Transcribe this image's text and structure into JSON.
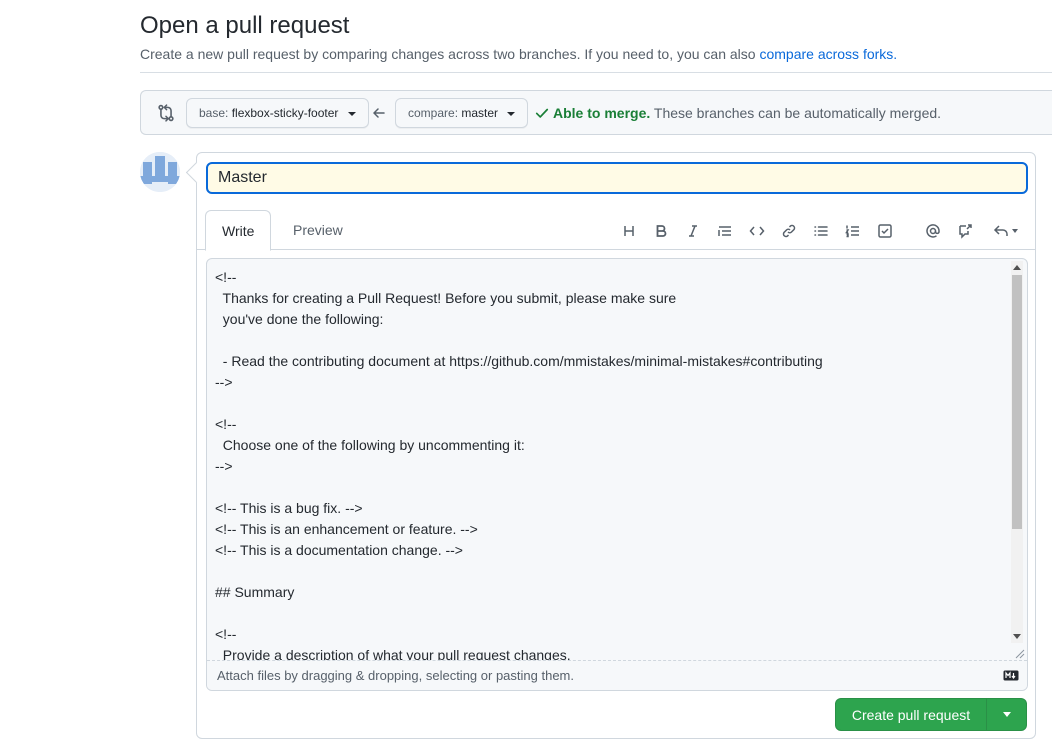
{
  "header": {
    "title": "Open a pull request",
    "subtitle": "Create a new pull request by comparing changes across two branches. If you need to, you can also ",
    "subtitle_link": "compare across forks."
  },
  "compare": {
    "base_label": "base:",
    "base_branch": "flexbox-sticky-footer",
    "compare_label": "compare:",
    "compare_branch": "master",
    "merge_ok": "Able to merge.",
    "merge_note": " These branches can be automatically merged."
  },
  "form": {
    "title_value": "Master",
    "tabs": [
      {
        "label": "Write"
      },
      {
        "label": "Preview"
      }
    ],
    "toolbar": [
      "heading-icon",
      "bold-icon",
      "italic-icon",
      "quote-icon",
      "code-icon",
      "link-icon",
      "bulleted-list-icon",
      "numbered-list-icon",
      "task-list-icon",
      "mention-icon",
      "reference-icon",
      "reply-icon"
    ],
    "body": "<!--\n  Thanks for creating a Pull Request! Before you submit, please make sure\n  you've done the following:\n\n  - Read the contributing document at https://github.com/mmistakes/minimal-mistakes#contributing\n-->\n\n<!--\n  Choose one of the following by uncommenting it:\n-->\n\n<!-- This is a bug fix. -->\n<!-- This is an enhancement or feature. -->\n<!-- This is a documentation change. -->\n\n## Summary\n\n<!--\n  Provide a description of what your pull request changes.",
    "attach_hint": "Attach files by dragging & dropping, selecting or pasting them.",
    "submit_label": "Create pull request"
  },
  "colors": {
    "accent": "#0969da",
    "success": "#1a7f37",
    "button_green": "#2da44e"
  }
}
